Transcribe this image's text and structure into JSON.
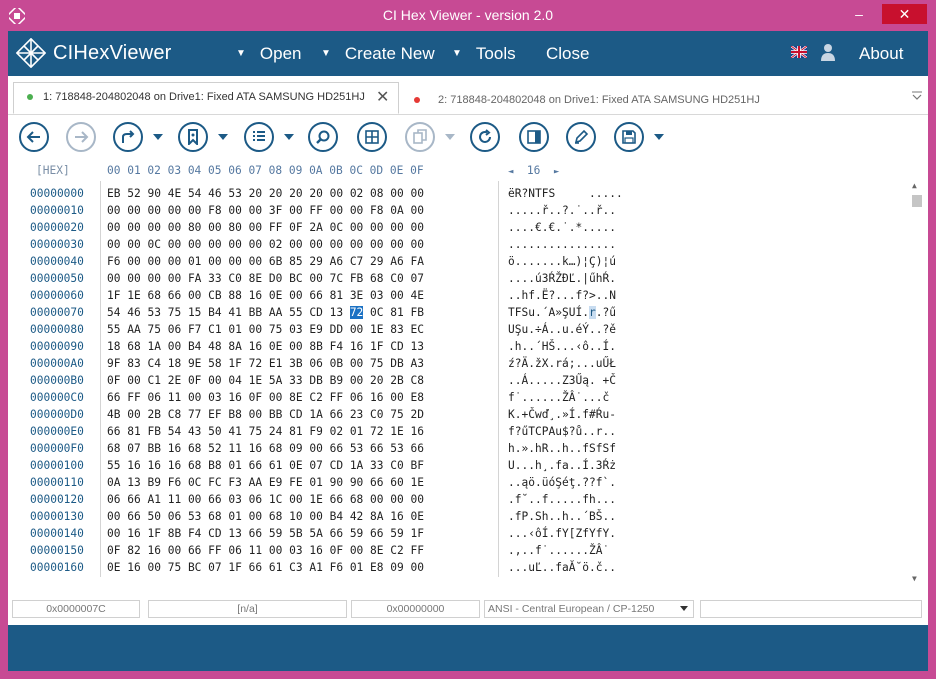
{
  "window": {
    "title": "CI Hex Viewer - version 2.0",
    "min": "–",
    "max": "□",
    "close": "✕"
  },
  "menubar": {
    "brand": "CIHexViewer",
    "open": "Open",
    "create_new": "Create New",
    "tools": "Tools",
    "close": "Close",
    "about": "About"
  },
  "tabs": [
    {
      "label": "1: 718848-204802048 on Drive1: Fixed ATA SAMSUNG HD251HJ",
      "dot_color": "#4caf50",
      "close": "✕"
    },
    {
      "label": "2: 718848-204802048 on Drive1: Fixed ATA SAMSUNG HD251HJ",
      "dot_color": "#e53935"
    }
  ],
  "toolbar": {
    "icons": [
      "back-icon",
      "forward-icon",
      "redo-icon",
      "bookmark-icon",
      "list-icon",
      "search-icon",
      "grid-icon",
      "copy-icon",
      "refresh-icon",
      "panel-icon",
      "edit-icon",
      "save-icon"
    ]
  },
  "hexview": {
    "header_hex": "[HEX]",
    "columns": "00 01 02 03 04 05 06 07 08 09 0A 0B 0C 0D 0E 0F",
    "page_prev": "◄",
    "page_size": "16",
    "page_next": "►",
    "selected_byte": {
      "row": 7,
      "col": 12,
      "value": "72",
      "ascii": "r"
    },
    "rows": [
      {
        "offset": "00000000",
        "hex": "EB 52 90 4E 54 46 53 20 20 20 20 00 02 08 00 00",
        "ascii": "ëR?NTFS     ....."
      },
      {
        "offset": "00000010",
        "hex": "00 00 00 00 00 F8 00 00 3F 00 FF 00 00 F8 0A 00",
        "ascii": ".....ř..?.˙..ř.."
      },
      {
        "offset": "00000020",
        "hex": "00 00 00 00 80 00 80 00 FF 0F 2A 0C 00 00 00 00",
        "ascii": "....€.€.˙.*....."
      },
      {
        "offset": "00000030",
        "hex": "00 00 0C 00 00 00 00 00 02 00 00 00 00 00 00 00",
        "ascii": "................"
      },
      {
        "offset": "00000040",
        "hex": "F6 00 00 00 01 00 00 00 6B 85 29 A6 C7 29 A6 FA",
        "ascii": "ö.......k…)¦Ç)¦ú"
      },
      {
        "offset": "00000050",
        "hex": "00 00 00 00 FA 33 C0 8E D0 BC 00 7C FB 68 C0 07",
        "ascii": "....ú3ŔŽĐĽ.|űhŔ."
      },
      {
        "offset": "00000060",
        "hex": "1F 1E 68 66 00 CB 88 16 0E 00 66 81 3E 03 00 4E",
        "ascii": "..hf.Ë?...f?>..N"
      },
      {
        "offset": "00000070",
        "hex": "54 46 53 75 15 B4 41 BB AA 55 CD 13 72 0C 81 FB",
        "ascii": "TFSu.´A»ŞUÍ.r.?ű"
      },
      {
        "offset": "00000080",
        "hex": "55 AA 75 06 F7 C1 01 00 75 03 E9 DD 00 1E 83 EC",
        "ascii": "UŞu.÷Á..u.éÝ..?ě"
      },
      {
        "offset": "00000090",
        "hex": "18 68 1A 00 B4 48 8A 16 0E 00 8B F4 16 1F CD 13",
        "ascii": ".h..´HŠ...‹ô..Í."
      },
      {
        "offset": "000000A0",
        "hex": "9F 83 C4 18 9E 58 1F 72 E1 3B 06 0B 00 75 DB A3",
        "ascii": "ź?Ä.žX.rá;...uŰŁ"
      },
      {
        "offset": "000000B0",
        "hex": "0F 00 C1 2E 0F 00 04 1E 5A 33 DB B9 00 20 2B C8",
        "ascii": "..Á.....Z3Űą. +Č"
      },
      {
        "offset": "000000C0",
        "hex": "66 FF 06 11 00 03 16 0F 00 8E C2 FF 06 16 00 E8",
        "ascii": "f˙......ŽÂ˙...č"
      },
      {
        "offset": "000000D0",
        "hex": "4B 00 2B C8 77 EF B8 00 BB CD 1A 66 23 C0 75 2D",
        "ascii": "K.+Čwď¸.»Í.f#Ŕu-"
      },
      {
        "offset": "000000E0",
        "hex": "66 81 FB 54 43 50 41 75 24 81 F9 02 01 72 1E 16",
        "ascii": "f?űTCPAu$?ů..r.."
      },
      {
        "offset": "000000F0",
        "hex": "68 07 BB 16 68 52 11 16 68 09 00 66 53 66 53 66",
        "ascii": "h.».hR..h..fSfSf"
      },
      {
        "offset": "00000100",
        "hex": "55 16 16 16 68 B8 01 66 61 0E 07 CD 1A 33 C0 BF",
        "ascii": "U...h¸.fa..Í.3Ŕż"
      },
      {
        "offset": "00000110",
        "hex": "0A 13 B9 F6 0C FC F3 AA E9 FE 01 90 90 66 60 1E",
        "ascii": "..ąö.üóŞéţ.??f`."
      },
      {
        "offset": "00000120",
        "hex": "06 66 A1 11 00 66 03 06 1C 00 1E 66 68 00 00 00",
        "ascii": ".f˘..f.....fh..."
      },
      {
        "offset": "00000130",
        "hex": "00 66 50 06 53 68 01 00 68 10 00 B4 42 8A 16 0E",
        "ascii": ".fP.Sh..h..´BŠ.."
      },
      {
        "offset": "00000140",
        "hex": "00 16 1F 8B F4 CD 13 66 59 5B 5A 66 59 66 59 1F",
        "ascii": "...‹ôÍ.fY[ZfYfY."
      },
      {
        "offset": "00000150",
        "hex": "0F 82 16 00 66 FF 06 11 00 03 16 0F 00 8E C2 FF",
        "ascii": ".,..f˙......ŽÂ˙"
      },
      {
        "offset": "00000160",
        "hex": "0E 16 00 75 BC 07 1F 66 61 C3 A1 F6 01 E8 09 00",
        "ascii": "...uĽ..faĂ˘ö.č.."
      }
    ]
  },
  "statusbar": {
    "offset": "0x0000007C",
    "selection": "[n/a]",
    "value": "0x00000000",
    "encoding": "ANSI - Central European / CP-1250",
    "extra": ""
  }
}
